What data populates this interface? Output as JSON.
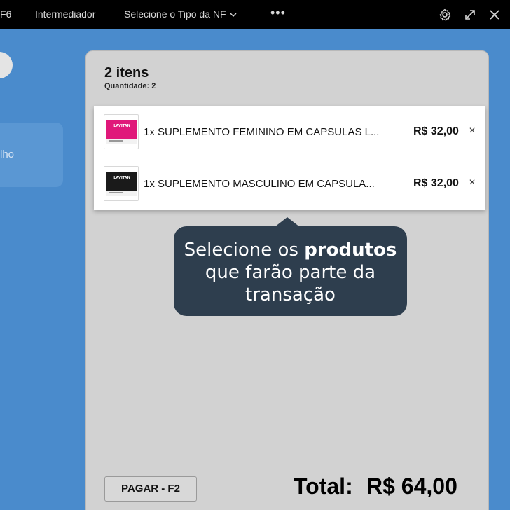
{
  "topbar": {
    "f6_label": "F6",
    "intermediador_label": "Intermediador",
    "tipo_nf_label": "Selecione o Tipo da NF",
    "more_label": "•••"
  },
  "left": {
    "card_text": "lho"
  },
  "cart": {
    "title": "2 itens",
    "quantity_label": "Quantidade: 2",
    "items": [
      {
        "name": "1x SUPLEMENTO FEMININO EM CAPSULAS L...",
        "price": "R$ 32,00",
        "remove": "×",
        "thumb_color": "#e0187a"
      },
      {
        "name": "1x SUPLEMENTO MASCULINO EM CAPSULA...",
        "price": "R$ 32,00",
        "remove": "×",
        "thumb_color": "#1a1a1a"
      }
    ]
  },
  "tooltip": {
    "line1_prefix": "Selecione os ",
    "line1_bold": "produtos",
    "line2": "que farão parte da",
    "line3": "transação"
  },
  "footer": {
    "pay_button": "PAGAR - F2",
    "total_label": "Total:",
    "total_value": "R$ 64,00"
  }
}
